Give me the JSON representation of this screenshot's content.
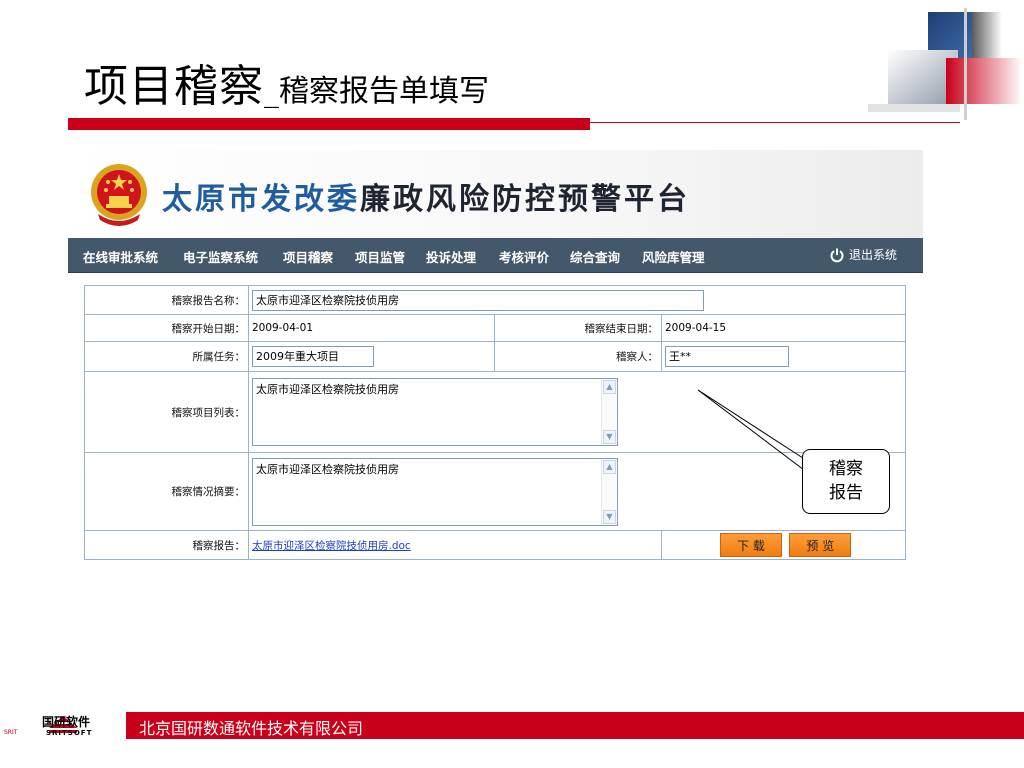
{
  "slide": {
    "title_main": "项目稽察",
    "title_sub": "_稽察报告单填写"
  },
  "banner": {
    "title_blue": "太原市发改委",
    "title_dark": "廉政风险防控预警平台"
  },
  "nav": {
    "items": [
      "在线审批系统",
      "电子监察系统",
      "项目稽察",
      "项目监管",
      "投诉处理",
      "考核评价",
      "综合查询",
      "风险库管理"
    ],
    "logout_label": "退出系统"
  },
  "form": {
    "report_name_label": "稽察报告名称：",
    "report_name_value": "太原市迎泽区检察院技侦用房",
    "start_date_label": "稽察开始日期：",
    "start_date_value": "2009-04-01",
    "end_date_label": "稽察结束日期：",
    "end_date_value": "2009-04-15",
    "task_label": "所属任务：",
    "task_value": "2009年重大项目",
    "inspector_label": "稽察人：",
    "inspector_value": "王**",
    "project_list_label": "稽察项目列表：",
    "project_list_value": "太原市迎泽区检察院技侦用房",
    "summary_label": "稽察情况摘要：",
    "summary_value": "太原市迎泽区检察院技侦用房",
    "report_label": "稽察报告：",
    "report_file": "太原市迎泽区检察院技侦用房.doc",
    "download_label": "下 载",
    "preview_label": "预 览"
  },
  "callout": {
    "line1": "稽察",
    "line2": "报告"
  },
  "footer": {
    "company": "北京国研数通软件技术有限公司",
    "logo_cn": "国研软件",
    "logo_en": "SRITSOFT",
    "logo_small": "SRIT"
  },
  "colors": {
    "accent_red": "#c8001a",
    "nav_bg": "#43586a",
    "banner_blue": "#1f5d9e",
    "button_orange": "#f07d12"
  }
}
